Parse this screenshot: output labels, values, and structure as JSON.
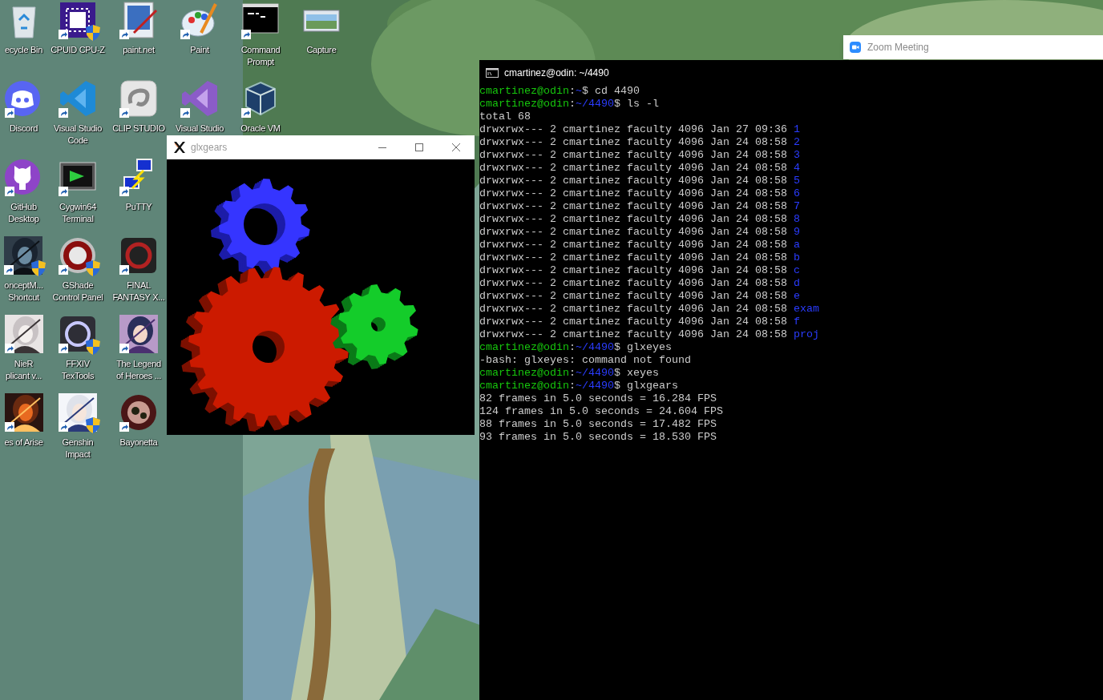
{
  "desktop": {
    "icon_columns": [
      [
        {
          "label": "ecycle Bin",
          "kind": "recycle-bin",
          "shortcut": false,
          "shield": false
        },
        {
          "label": "Discord",
          "kind": "discord",
          "shortcut": true,
          "shield": false
        },
        {
          "label": "GitHub\nDesktop",
          "kind": "github",
          "shortcut": true,
          "shield": false
        },
        {
          "label": "onceptM...\nShortcut",
          "kind": "hood",
          "shortcut": true,
          "shield": true
        },
        {
          "label": "NieR\nplicant v...",
          "kind": "portrait-light",
          "shortcut": true,
          "shield": false
        },
        {
          "label": "es of Arise",
          "kind": "fire",
          "shortcut": true,
          "shield": false
        }
      ],
      [
        {
          "label": "CPUID CPU-Z",
          "kind": "chip",
          "shortcut": true,
          "shield": true
        },
        {
          "label": "Visual Studio\nCode",
          "kind": "vscode",
          "shortcut": true,
          "shield": false
        },
        {
          "label": "Cygwin64\nTerminal",
          "kind": "cygwin",
          "shortcut": true,
          "shield": false
        },
        {
          "label": "GShade\nControl Panel",
          "kind": "gshade",
          "shortcut": true,
          "shield": true
        },
        {
          "label": "FFXIV\nTexTools",
          "kind": "ffxiv",
          "shortcut": true,
          "shield": true
        },
        {
          "label": "Genshin\nImpact",
          "kind": "portrait-bright",
          "shortcut": true,
          "shield": true
        }
      ],
      [
        {
          "label": "paint.net",
          "kind": "paintnet",
          "shortcut": true,
          "shield": false
        },
        {
          "label": "CLIP STUDIO",
          "kind": "clip",
          "shortcut": true,
          "shield": false
        },
        {
          "label": "PuTTY",
          "kind": "putty",
          "shortcut": true,
          "shield": false
        },
        {
          "label": "FINAL\nFANTASY X...",
          "kind": "ff",
          "shortcut": true,
          "shield": false
        },
        {
          "label": "The Legend\nof Heroes ...",
          "kind": "portrait-dark",
          "shortcut": true,
          "shield": false
        },
        {
          "label": "Bayonetta",
          "kind": "bayonetta",
          "shortcut": true,
          "shield": false
        }
      ],
      [
        {
          "label": "Paint",
          "kind": "paint",
          "shortcut": true,
          "shield": false
        },
        {
          "label": "Visual Studio",
          "kind": "vs",
          "shortcut": true,
          "shield": false
        }
      ],
      [
        {
          "label": "Command\nPrompt",
          "kind": "cmd",
          "shortcut": true,
          "shield": false
        },
        {
          "label": "Oracle VM",
          "kind": "vbox",
          "shortcut": true,
          "shield": false
        }
      ],
      [
        {
          "label": "Capture",
          "kind": "capture",
          "shortcut": false,
          "shield": false
        }
      ]
    ]
  },
  "gears_window": {
    "title": "glxgears"
  },
  "zoom_window": {
    "title": "Zoom Meeting"
  },
  "terminal": {
    "title": "cmartinez@odin: ~/4490",
    "lines": [
      {
        "kind": "prompt",
        "user": "cmartinez@odin",
        "sep": ":",
        "path": "~",
        "command": "$ cd 4490"
      },
      {
        "kind": "prompt",
        "user": "cmartinez@odin",
        "sep": ":",
        "path": "~/4490",
        "command": "$ ls -l"
      },
      {
        "kind": "output",
        "text": "total 68"
      },
      {
        "kind": "listing",
        "text": "drwxrwx--- 2 cmartinez faculty 4096 Jan 27 09:36",
        "name": "1"
      },
      {
        "kind": "listing",
        "text": "drwxrwx--- 2 cmartinez faculty 4096 Jan 24 08:58",
        "name": "2"
      },
      {
        "kind": "listing",
        "text": "drwxrwx--- 2 cmartinez faculty 4096 Jan 24 08:58",
        "name": "3"
      },
      {
        "kind": "listing",
        "text": "drwxrwx--- 2 cmartinez faculty 4096 Jan 24 08:58",
        "name": "4"
      },
      {
        "kind": "listing",
        "text": "drwxrwx--- 2 cmartinez faculty 4096 Jan 24 08:58",
        "name": "5"
      },
      {
        "kind": "listing",
        "text": "drwxrwx--- 2 cmartinez faculty 4096 Jan 24 08:58",
        "name": "6"
      },
      {
        "kind": "listing",
        "text": "drwxrwx--- 2 cmartinez faculty 4096 Jan 24 08:58",
        "name": "7"
      },
      {
        "kind": "listing",
        "text": "drwxrwx--- 2 cmartinez faculty 4096 Jan 24 08:58",
        "name": "8"
      },
      {
        "kind": "listing",
        "text": "drwxrwx--- 2 cmartinez faculty 4096 Jan 24 08:58",
        "name": "9"
      },
      {
        "kind": "listing",
        "text": "drwxrwx--- 2 cmartinez faculty 4096 Jan 24 08:58",
        "name": "a"
      },
      {
        "kind": "listing",
        "text": "drwxrwx--- 2 cmartinez faculty 4096 Jan 24 08:58",
        "name": "b"
      },
      {
        "kind": "listing",
        "text": "drwxrwx--- 2 cmartinez faculty 4096 Jan 24 08:58",
        "name": "c"
      },
      {
        "kind": "listing",
        "text": "drwxrwx--- 2 cmartinez faculty 4096 Jan 24 08:58",
        "name": "d"
      },
      {
        "kind": "listing",
        "text": "drwxrwx--- 2 cmartinez faculty 4096 Jan 24 08:58",
        "name": "e"
      },
      {
        "kind": "listing",
        "text": "drwxrwx--- 2 cmartinez faculty 4096 Jan 24 08:58",
        "name": "exam"
      },
      {
        "kind": "listing",
        "text": "drwxrwx--- 2 cmartinez faculty 4096 Jan 24 08:58",
        "name": "f"
      },
      {
        "kind": "listing",
        "text": "drwxrwx--- 2 cmartinez faculty 4096 Jan 24 08:58",
        "name": "proj"
      },
      {
        "kind": "prompt",
        "user": "cmartinez@odin",
        "sep": ":",
        "path": "~/4490",
        "command": "$ glxeyes"
      },
      {
        "kind": "output",
        "text": "-bash: glxeyes: command not found"
      },
      {
        "kind": "prompt",
        "user": "cmartinez@odin",
        "sep": ":",
        "path": "~/4490",
        "command": "$ xeyes"
      },
      {
        "kind": "prompt",
        "user": "cmartinez@odin",
        "sep": ":",
        "path": "~/4490",
        "command": "$ glxgears"
      },
      {
        "kind": "output",
        "text": "82 frames in 5.0 seconds = 16.284 FPS"
      },
      {
        "kind": "output",
        "text": "124 frames in 5.0 seconds = 24.604 FPS"
      },
      {
        "kind": "output",
        "text": "88 frames in 5.0 seconds = 17.482 FPS"
      },
      {
        "kind": "output",
        "text": "93 frames in 5.0 seconds = 18.530 FPS"
      }
    ]
  }
}
